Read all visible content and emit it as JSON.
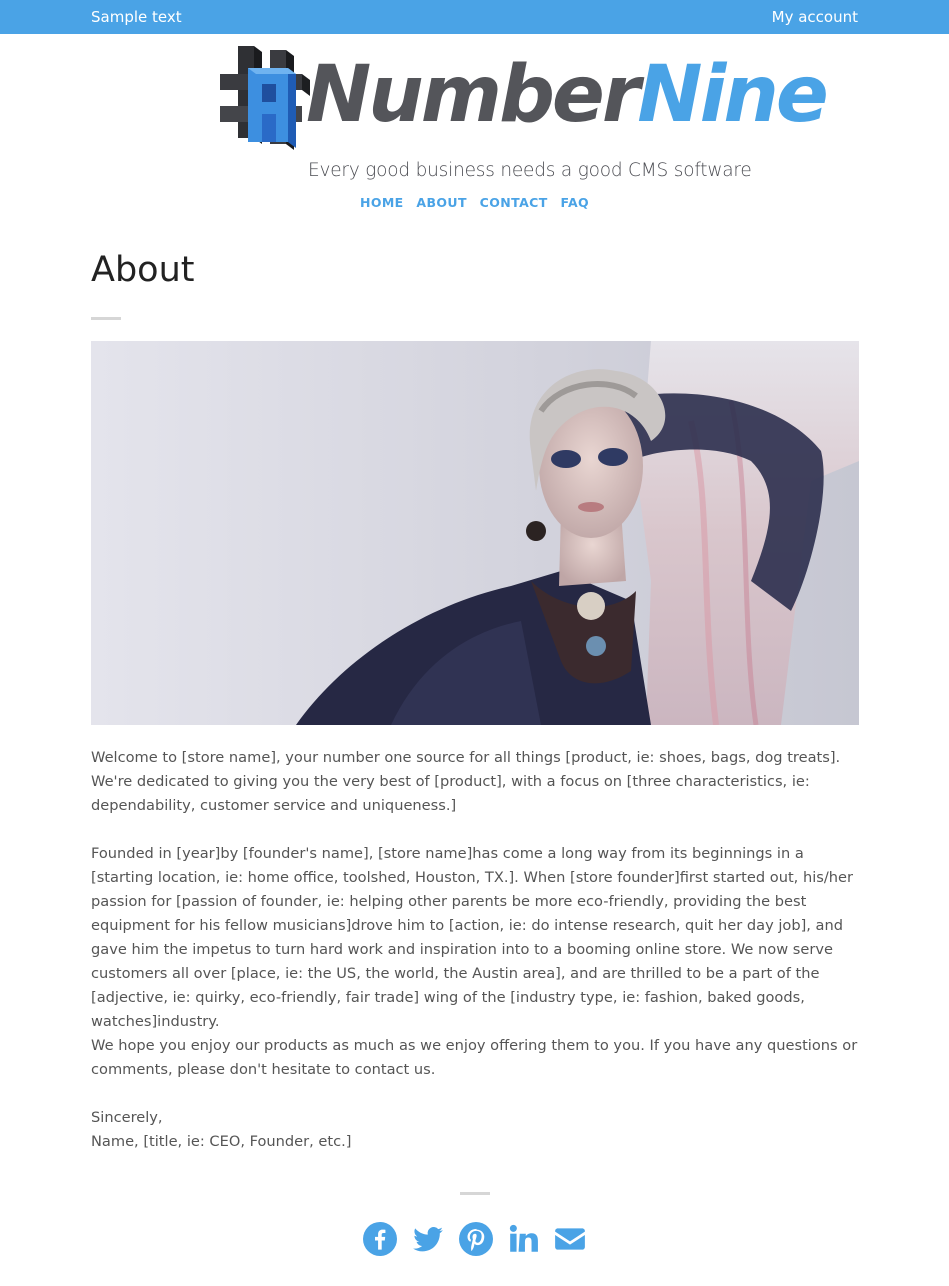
{
  "theme": {
    "accent": "#4aa3e6",
    "logo_dark": "#54555a"
  },
  "topbar": {
    "left_text": "Sample text",
    "account_link": "My account"
  },
  "logo": {
    "word_dark": "Number",
    "word_accent": "Nine",
    "tagline": "Every good business needs a good CMS software",
    "mark_icon": "hash-cube-logo-icon"
  },
  "nav": {
    "items": [
      {
        "label": "HOME"
      },
      {
        "label": "ABOUT"
      },
      {
        "label": "CONTACT"
      },
      {
        "label": "FAQ"
      }
    ]
  },
  "page": {
    "title": "About",
    "hero_image": "fashion-model-photo"
  },
  "content": {
    "p1": "Welcome to [store name], your number one source for all things [product, ie: shoes, bags, dog treats]. We're dedicated to giving you the very best of [product], with a focus on [three characteristics, ie: dependability, customer service and uniqueness.]",
    "p2": "Founded in [year]by [founder's name], [store name]has come a long way from its beginnings in a [starting location, ie: home office, toolshed, Houston, TX.]. When [store founder]first started out, his/her passion for [passion of founder, ie: helping other parents be more eco-friendly, providing the best equipment for his fellow musicians]drove him to [action, ie: do intense research, quit her day job], and gave him the impetus to turn hard work and inspiration into to a booming online store. We now serve customers all over [place, ie: the US, the world, the Austin area], and are thrilled to be a part of the [adjective, ie: quirky, eco-friendly, fair trade] wing of the [industry type, ie: fashion, baked goods, watches]industry.",
    "p3": "We hope you enjoy our products as much as we enjoy offering them to you. If you have any questions or comments, please don't hesitate to contact us.",
    "closing": "Sincerely,",
    "signature": "Name, [title, ie: CEO, Founder, etc.]"
  },
  "social": {
    "icons": [
      "facebook-icon",
      "twitter-icon",
      "pinterest-icon",
      "linkedin-icon",
      "email-icon"
    ]
  }
}
